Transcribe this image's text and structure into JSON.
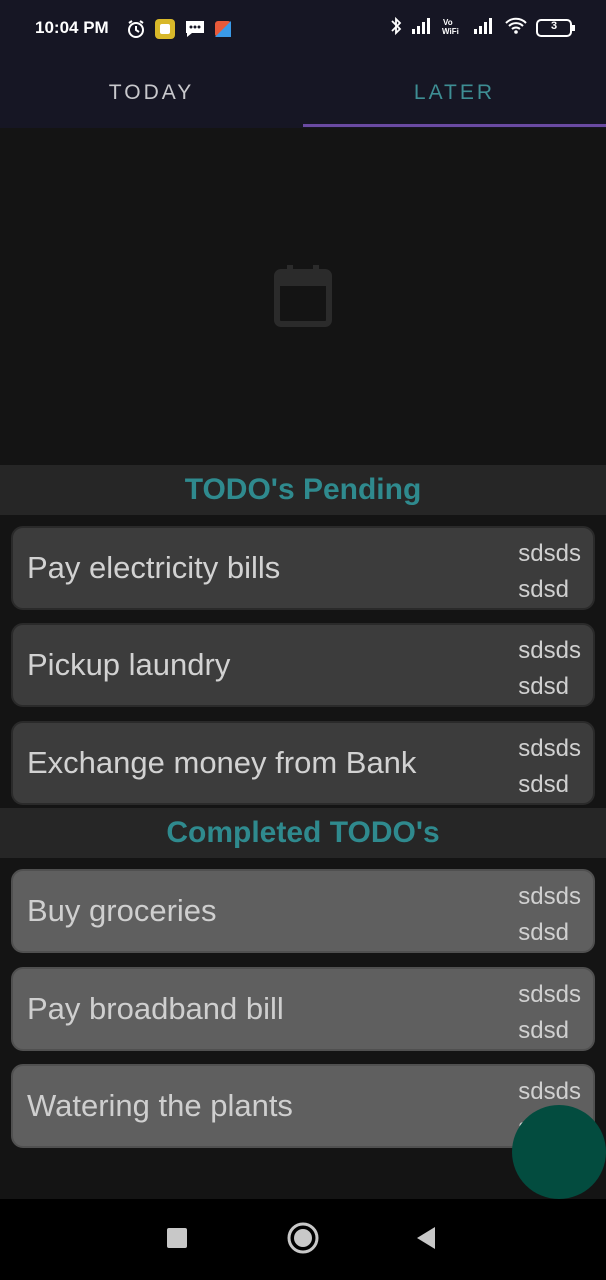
{
  "status_bar": {
    "time": "10:04 PM",
    "battery": "3",
    "icons": [
      "alarm-icon",
      "app-notification-icon",
      "message-icon",
      "app-icon",
      "bluetooth-icon",
      "signal-icon",
      "vowifi-icon",
      "signal-icon",
      "wifi-icon",
      "battery-icon"
    ]
  },
  "tabs": [
    {
      "label": "TODAY"
    },
    {
      "label": "LATER"
    }
  ],
  "colors": {
    "accent": "#2f8a8e",
    "tab_indicator": "#6a4aa2",
    "fab": "#034c3f"
  },
  "pending": {
    "title": "TODO's Pending",
    "items": [
      {
        "title": "Pay electricity bills",
        "meta1": "sdsds",
        "meta2": "sdsd"
      },
      {
        "title": "Pickup laundry",
        "meta1": "sdsds",
        "meta2": "sdsd"
      },
      {
        "title": "Exchange money from Bank",
        "meta1": "sdsds",
        "meta2": "sdsd"
      }
    ]
  },
  "completed": {
    "title": "Completed TODO's",
    "items": [
      {
        "title": "Buy groceries",
        "meta1": "sdsds",
        "meta2": "sdsd"
      },
      {
        "title": "Pay broadband bill",
        "meta1": "sdsds",
        "meta2": "sdsd"
      },
      {
        "title": "Watering the plants",
        "meta1": "sdsds",
        "meta2": "sdsd"
      }
    ]
  },
  "empty_state_icon": "calendar-icon",
  "nav": [
    "recents-square-icon",
    "home-circle-icon",
    "back-triangle-icon"
  ]
}
